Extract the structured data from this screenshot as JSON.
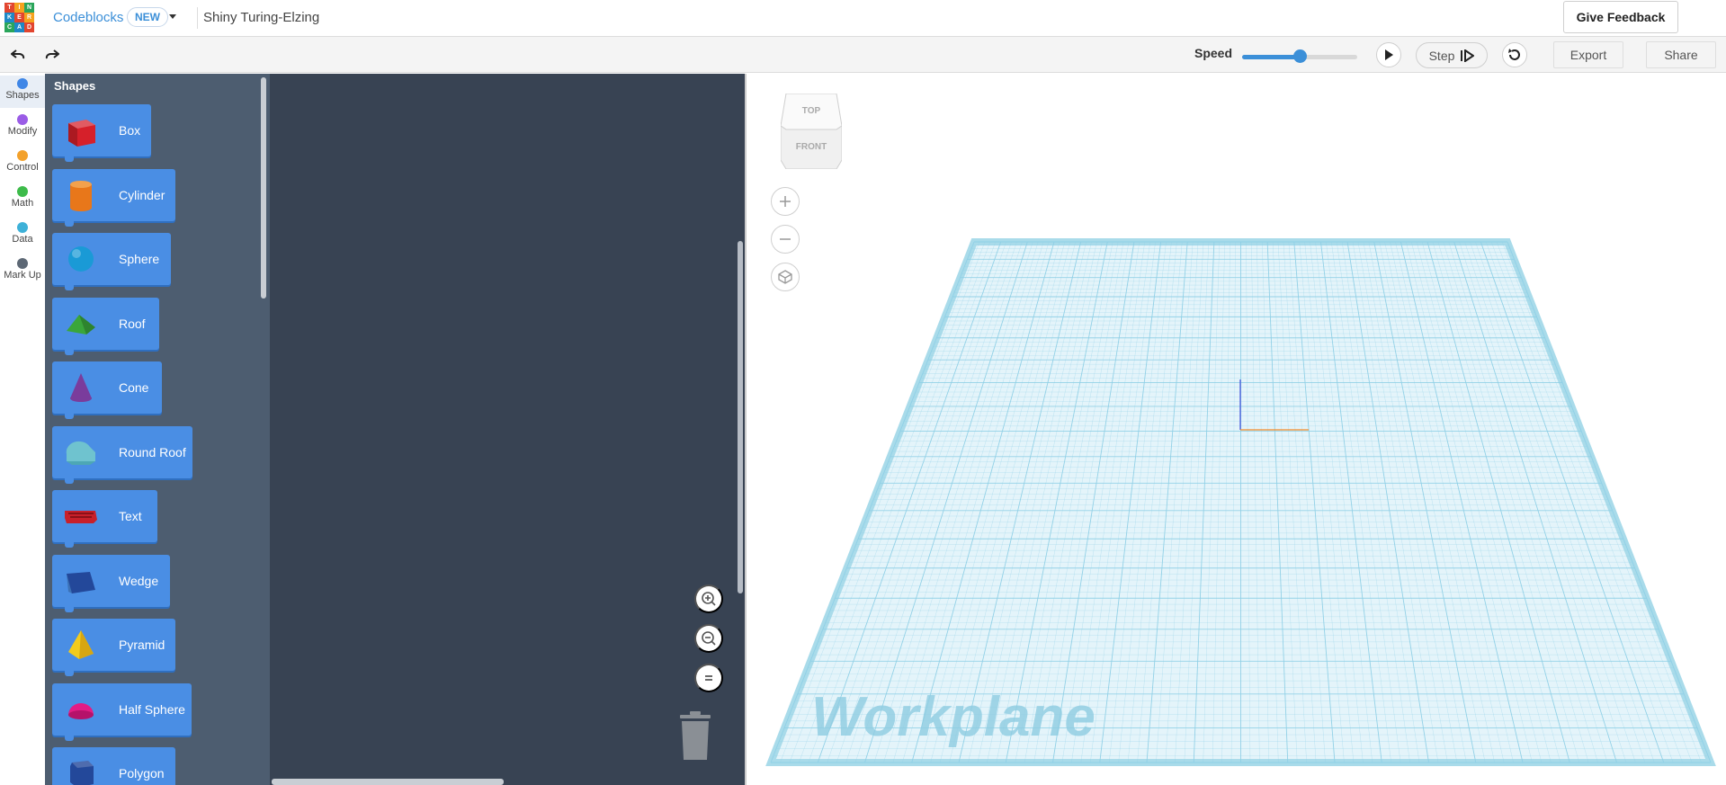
{
  "header": {
    "logo_letters": [
      "T",
      "I",
      "N",
      "K",
      "E",
      "R",
      "C",
      "A",
      "D"
    ],
    "logo_colors": [
      "#e2452f",
      "#f6a21e",
      "#2aa55a",
      "#1e88c7",
      "#e2452f",
      "#f6a21e",
      "#2aa55a",
      "#1e88c7",
      "#e2452f"
    ],
    "app_name": "Codeblocks",
    "new_badge": "NEW",
    "doc_title": "Shiny Turing-Elzing",
    "feedback_label": "Give Feedback"
  },
  "toolbar": {
    "undo_icon": "undo-icon",
    "redo_icon": "redo-icon",
    "speed_label": "Speed",
    "speed_value": 0.5,
    "step_label": "Step",
    "export_label": "Export",
    "share_label": "Share"
  },
  "categories": [
    {
      "label": "Shapes",
      "color": "#3f86e6",
      "active": true
    },
    {
      "label": "Modify",
      "color": "#9a5ce6",
      "active": false
    },
    {
      "label": "Control",
      "color": "#f3a12b",
      "active": false
    },
    {
      "label": "Math",
      "color": "#3dbb4a",
      "active": false
    },
    {
      "label": "Data",
      "color": "#3eb1d8",
      "active": false
    },
    {
      "label": "Mark Up",
      "color": "#5d6875",
      "active": false
    }
  ],
  "flyout": {
    "title": "Shapes",
    "blocks": [
      {
        "label": "Box",
        "icon": "box-shape-icon",
        "color": "#d6202a"
      },
      {
        "label": "Cylinder",
        "icon": "cylinder-shape-icon",
        "color": "#e8771a"
      },
      {
        "label": "Sphere",
        "icon": "sphere-shape-icon",
        "color": "#1a9ad6"
      },
      {
        "label": "Roof",
        "icon": "roof-shape-icon",
        "color": "#3aa63a"
      },
      {
        "label": "Cone",
        "icon": "cone-shape-icon",
        "color": "#7a3c9c"
      },
      {
        "label": "Round Roof",
        "icon": "round-roof-shape-icon",
        "color": "#6fc3cf"
      },
      {
        "label": "Text",
        "icon": "text-shape-icon",
        "color": "#c8202a"
      },
      {
        "label": "Wedge",
        "icon": "wedge-shape-icon",
        "color": "#23489a"
      },
      {
        "label": "Pyramid",
        "icon": "pyramid-shape-icon",
        "color": "#f2cb1c"
      },
      {
        "label": "Half Sphere",
        "icon": "half-sphere-shape-icon",
        "color": "#e31c85"
      },
      {
        "label": "Polygon",
        "icon": "polygon-shape-icon",
        "color": "#23489a"
      }
    ]
  },
  "viewport": {
    "cube_top": "TOP",
    "cube_front": "FRONT",
    "workplane_label": "Workplane",
    "grid_color": "#8fd0e6",
    "plane_color": "#e4f4fa"
  }
}
